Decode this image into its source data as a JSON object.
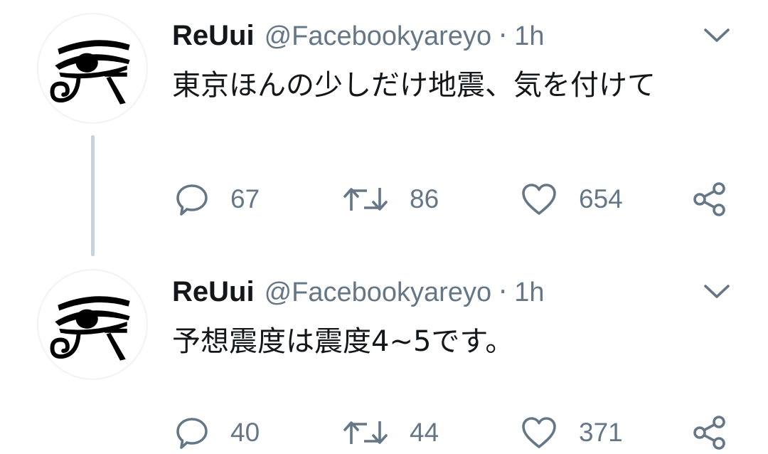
{
  "tweets": [
    {
      "display_name": "ReUui",
      "handle": "@Facebookyareyo",
      "separator": "·",
      "time": "1h",
      "text": "東京ほんの少しだけ地震、気を付けて",
      "replies": "67",
      "retweets": "86",
      "likes": "654"
    },
    {
      "display_name": "ReUui",
      "handle": "@Facebookyareyo",
      "separator": "·",
      "time": "1h",
      "text": "予想震度は震度4~5です。",
      "replies": "40",
      "retweets": "44",
      "likes": "371"
    }
  ],
  "icons": {
    "avatar": "eye-of-horus-icon",
    "menu": "chevron-down-icon",
    "reply": "reply-bubble-icon",
    "retweet": "retweet-icon",
    "like": "heart-icon",
    "share": "share-icon"
  },
  "colors": {
    "text": "#14171a",
    "secondary": "#657786",
    "thread_line": "#c9d3db",
    "background": "#ffffff"
  }
}
